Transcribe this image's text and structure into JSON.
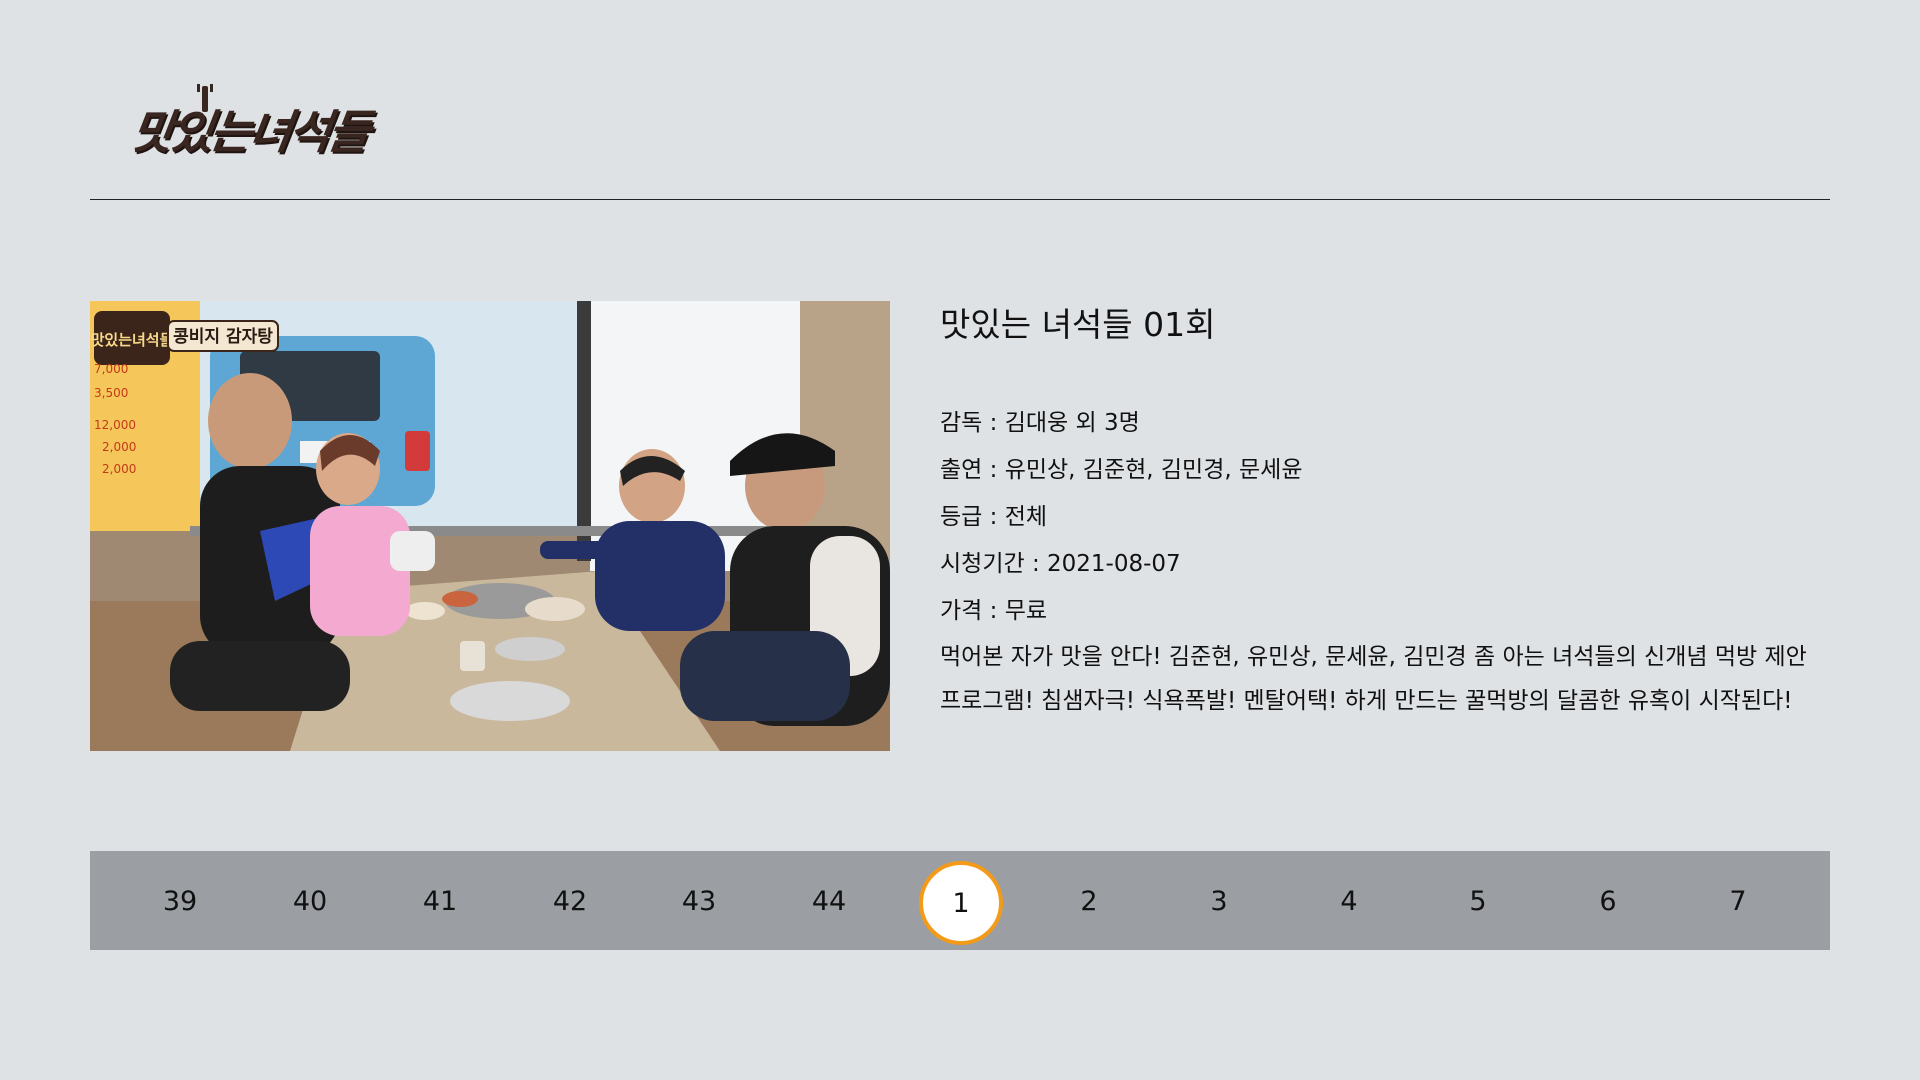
{
  "logo": {
    "text": "맛있는녀석들"
  },
  "program": {
    "title": "맛있는 녀석들 01회",
    "meta": [
      {
        "label": "감독 : 김대웅 외 3명"
      },
      {
        "label": "출연 : 유민상, 김준현, 김민경, 문세윤"
      },
      {
        "label": "등급 : 전체"
      },
      {
        "label": "시청기간 : 2021-08-07"
      },
      {
        "label": "가격 : 무료"
      }
    ],
    "description": "먹어본 자가 맛을 안다! 김준현, 유민상, 문세윤, 김민경 좀 아는 녀석들의 신개념 먹방 제안\n프로그램! 침샘자극! 식욕폭발! 멘탈어택! 하게 만드는 꿀먹방의 달콤한 유혹이 시작된다!"
  },
  "thumbnail": {
    "overlay_logo": "맛있는녀석들",
    "overlay_caption": "콩비지 감자탕",
    "price_signs": [
      "7,000",
      "3,500",
      "12,000",
      "2,000",
      "2,000"
    ]
  },
  "episodes": {
    "items": [
      "39",
      "40",
      "41",
      "42",
      "43",
      "44",
      "1",
      "2",
      "3",
      "4",
      "5",
      "6",
      "7"
    ],
    "selected": "1"
  },
  "colors": {
    "background": "#dfe2e5",
    "episode_bar": "#9b9fa3",
    "selected_ring": "#f39a18"
  }
}
